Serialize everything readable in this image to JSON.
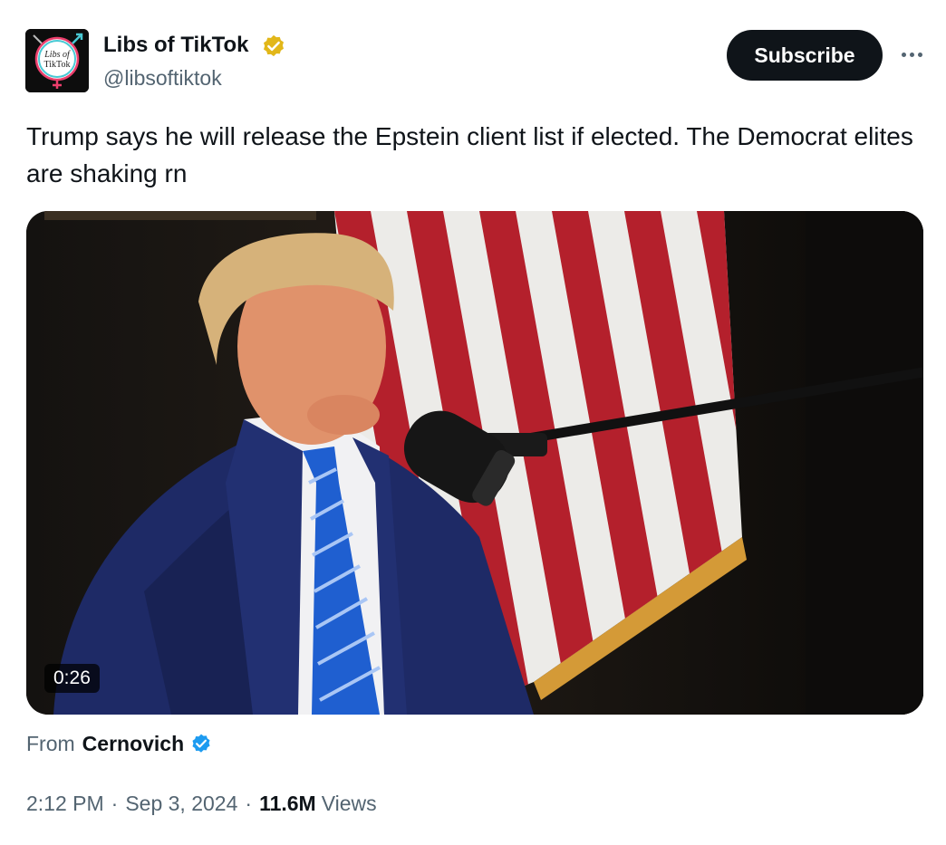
{
  "author": {
    "display_name": "Libs of TikTok",
    "handle": "@libsoftiktok",
    "avatar_text": "Libs of TikTok",
    "verified_badge": "gold-check-icon"
  },
  "actions": {
    "subscribe_label": "Subscribe",
    "more_icon": "more-horizontal-icon"
  },
  "post": {
    "text": "Trump says he will release the Epstein client list if elected. The Democrat elites are shaking rn"
  },
  "video": {
    "duration": "0:26"
  },
  "attribution": {
    "prefix": "From",
    "name": "Cernovich",
    "badge": "blue-check-icon"
  },
  "meta": {
    "time": "2:12 PM",
    "separator": "·",
    "date": "Sep 3, 2024",
    "views_count": "11.6M",
    "views_label": "Views"
  },
  "colors": {
    "primary_text": "#0f1419",
    "secondary_text": "#536471",
    "button_bg": "#0f1419",
    "verified_blue": "#1d9bf0",
    "verified_gold": "#e2b719"
  }
}
